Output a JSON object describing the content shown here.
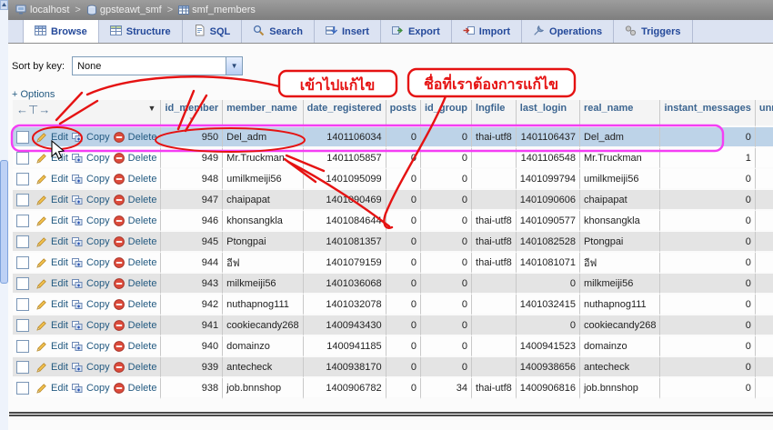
{
  "breadcrumb": {
    "separator": ">",
    "items": [
      {
        "label": "localhost",
        "icon": "server-icon"
      },
      {
        "label": "gpsteawt_smf",
        "icon": "database-icon"
      },
      {
        "label": "smf_members",
        "icon": "table-icon"
      }
    ]
  },
  "tabs": [
    {
      "label": "Browse",
      "icon": "browse-icon",
      "active": true
    },
    {
      "label": "Structure",
      "icon": "structure-icon",
      "active": false
    },
    {
      "label": "SQL",
      "icon": "sql-icon",
      "active": false
    },
    {
      "label": "Search",
      "icon": "search-icon",
      "active": false
    },
    {
      "label": "Insert",
      "icon": "insert-icon",
      "active": false
    },
    {
      "label": "Export",
      "icon": "export-icon",
      "active": false
    },
    {
      "label": "Import",
      "icon": "import-icon",
      "active": false
    },
    {
      "label": "Operations",
      "icon": "operations-icon",
      "active": false
    },
    {
      "label": "Triggers",
      "icon": "triggers-icon",
      "active": false
    }
  ],
  "sort": {
    "label": "Sort by key:",
    "value": "None"
  },
  "options_link": "+ Options",
  "icons": {
    "dropdown_arrow": "▼",
    "actions_menu": "▼",
    "sort_desc": "▼",
    "nav_arrows": "←⊤→",
    "scroll_up": "▲"
  },
  "table": {
    "action_labels": {
      "edit": "Edit",
      "copy": "Copy",
      "delete": "Delete"
    },
    "columns": [
      {
        "key": "id_member",
        "label": "id_member",
        "sorted": true
      },
      {
        "key": "member_name",
        "label": "member_name",
        "sorted": false
      },
      {
        "key": "date_registered",
        "label": "date_registered",
        "sorted": false
      },
      {
        "key": "posts",
        "label": "posts",
        "sorted": false
      },
      {
        "key": "id_group",
        "label": "id_group",
        "sorted": false
      },
      {
        "key": "lngfile",
        "label": "lngfile",
        "sorted": false
      },
      {
        "key": "last_login",
        "label": "last_login",
        "sorted": false
      },
      {
        "key": "real_name",
        "label": "real_name",
        "sorted": false
      },
      {
        "key": "instant_messages",
        "label": "instant_messages",
        "sorted": false
      },
      {
        "key": "unread_messages",
        "label": "unread_messages",
        "sorted": false
      }
    ],
    "rows": [
      {
        "shade": "selected",
        "id_member": "950",
        "member_name": "Del_adm",
        "date_registered": "1401106034",
        "posts": "0",
        "id_group": "0",
        "lngfile": "thai-utf8",
        "last_login": "1401106437",
        "real_name": "Del_adm",
        "instant_messages": "0",
        "unread_messages": ""
      },
      {
        "shade": "white",
        "id_member": "949",
        "member_name": "Mr.Truckman",
        "date_registered": "1401105857",
        "posts": "0",
        "id_group": "0",
        "lngfile": "",
        "last_login": "1401106548",
        "real_name": "Mr.Truckman",
        "instant_messages": "1",
        "unread_messages": ""
      },
      {
        "shade": "white",
        "id_member": "948",
        "member_name": "umilkmeiji56",
        "date_registered": "1401095099",
        "posts": "0",
        "id_group": "0",
        "lngfile": "",
        "last_login": "1401099794",
        "real_name": "umilkmeiji56",
        "instant_messages": "0",
        "unread_messages": ""
      },
      {
        "shade": "gray",
        "id_member": "947",
        "member_name": "chaipapat",
        "date_registered": "1401090469",
        "posts": "0",
        "id_group": "0",
        "lngfile": "",
        "last_login": "1401090606",
        "real_name": "chaipapat",
        "instant_messages": "0",
        "unread_messages": ""
      },
      {
        "shade": "white",
        "id_member": "946",
        "member_name": "khonsangkla",
        "date_registered": "1401084644",
        "posts": "0",
        "id_group": "0",
        "lngfile": "thai-utf8",
        "last_login": "1401090577",
        "real_name": "khonsangkla",
        "instant_messages": "0",
        "unread_messages": ""
      },
      {
        "shade": "gray",
        "id_member": "945",
        "member_name": "Ptongpai",
        "date_registered": "1401081357",
        "posts": "0",
        "id_group": "0",
        "lngfile": "thai-utf8",
        "last_login": "1401082528",
        "real_name": "Ptongpai",
        "instant_messages": "0",
        "unread_messages": ""
      },
      {
        "shade": "white",
        "id_member": "944",
        "member_name": "อีฟ",
        "date_registered": "1401079159",
        "posts": "0",
        "id_group": "0",
        "lngfile": "thai-utf8",
        "last_login": "1401081071",
        "real_name": "อีฟ",
        "instant_messages": "0",
        "unread_messages": ""
      },
      {
        "shade": "gray",
        "id_member": "943",
        "member_name": "milkmeiji56",
        "date_registered": "1401036068",
        "posts": "0",
        "id_group": "0",
        "lngfile": "",
        "last_login": "0",
        "real_name": "milkmeiji56",
        "instant_messages": "0",
        "unread_messages": ""
      },
      {
        "shade": "white",
        "id_member": "942",
        "member_name": "nuthapnog111",
        "date_registered": "1401032078",
        "posts": "0",
        "id_group": "0",
        "lngfile": "",
        "last_login": "1401032415",
        "real_name": "nuthapnog111",
        "instant_messages": "0",
        "unread_messages": ""
      },
      {
        "shade": "gray",
        "id_member": "941",
        "member_name": "cookiecandy268",
        "date_registered": "1400943430",
        "posts": "0",
        "id_group": "0",
        "lngfile": "",
        "last_login": "0",
        "real_name": "cookiecandy268",
        "instant_messages": "0",
        "unread_messages": ""
      },
      {
        "shade": "white",
        "id_member": "940",
        "member_name": "domainzo",
        "date_registered": "1400941185",
        "posts": "0",
        "id_group": "0",
        "lngfile": "",
        "last_login": "1400941523",
        "real_name": "domainzo",
        "instant_messages": "0",
        "unread_messages": ""
      },
      {
        "shade": "gray",
        "id_member": "939",
        "member_name": "antecheck",
        "date_registered": "1400938170",
        "posts": "0",
        "id_group": "0",
        "lngfile": "",
        "last_login": "1400938656",
        "real_name": "antecheck",
        "instant_messages": "0",
        "unread_messages": ""
      },
      {
        "shade": "white",
        "id_member": "938",
        "member_name": "job.bnnshop",
        "date_registered": "1400906782",
        "posts": "0",
        "id_group": "34",
        "lngfile": "thai-utf8",
        "last_login": "1400906816",
        "real_name": "job.bnnshop",
        "instant_messages": "0",
        "unread_messages": ""
      }
    ]
  },
  "annotations": {
    "callout_edit": "เข้าไปแก้ไข",
    "callout_name": "ชื่อที่เราต้องการแก้ไข"
  },
  "colors": {
    "annotation_red": "#e51212",
    "annotation_pink": "#f43ef4",
    "selected_row": "#bdd3e8",
    "link_blue": "#235a81",
    "tab_text": "#24499a"
  }
}
